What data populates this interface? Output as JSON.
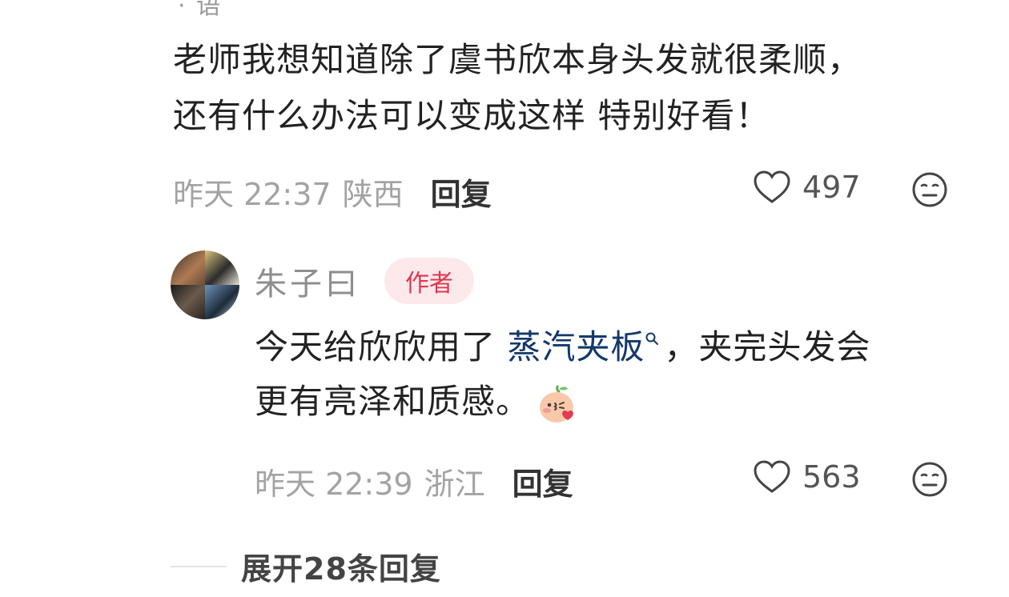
{
  "comment": {
    "author_partial": "· 语",
    "text_line1": "老师我想知道除了虞书欣本身头发就很柔顺，",
    "text_line2": "还有什么办法可以变成这样 特别好看！",
    "time": "昨天 22:37",
    "location": "陕西",
    "reply_label": "回复",
    "likes": "497"
  },
  "reply": {
    "author": "朱子曰",
    "badge": "作者",
    "text_before": "今天给欣欣用了 ",
    "link_text": "蒸汽夹板",
    "text_after_line1": "，夹完头发会",
    "text_line2": "更有亮泽和质感。",
    "time": "昨天 22:39",
    "location": "浙江",
    "reply_label": "回复",
    "likes": "563",
    "emoji": "blush-peach-emoji"
  },
  "expand": {
    "label": "展开28条回复"
  },
  "colors": {
    "link": "#13386c",
    "badge_bg": "#fde9ec",
    "badge_text": "#e0364f",
    "meta": "#a3a3a3"
  }
}
